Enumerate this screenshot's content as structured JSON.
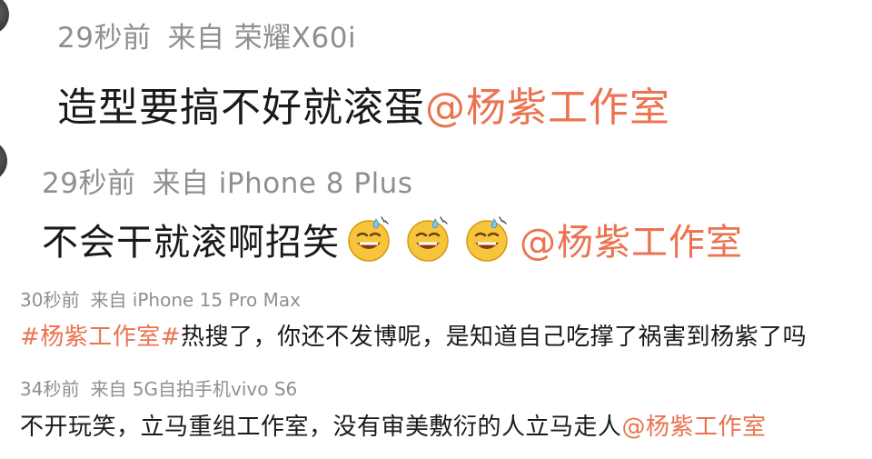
{
  "comments": [
    {
      "time": "29秒前",
      "source": "来自 荣耀X60i",
      "text": "造型要搞不好就滚蛋",
      "mention": "@杨紫工作室"
    },
    {
      "time": "29秒前",
      "source": "来自 iPhone 8 Plus",
      "text": "不会干就滚啊招笑",
      "emoji": "grinning-sweat-emoji",
      "mention": "@杨紫工作室"
    },
    {
      "time": "30秒前",
      "source": "来自 iPhone 15 Pro Max",
      "hashtag": "#杨紫工作室#",
      "text": "热搜了，你还不发博呢，是知道自己吃撑了祸害到杨紫了吗"
    },
    {
      "time": "34秒前",
      "source": "来自 5G自拍手机vivo S6",
      "text": "不开玩笑，立马重组工作室，没有审美敷衍的人立马走人",
      "mention": "@杨紫工作室"
    }
  ],
  "colors": {
    "link": "#eb7350",
    "meta": "#8f8f8f",
    "text": "#1a1a1a"
  }
}
